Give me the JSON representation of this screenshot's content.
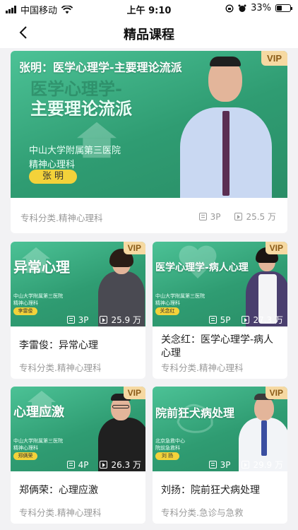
{
  "status_bar": {
    "carrier": "中国移动",
    "time": "上午 9:10",
    "battery": "33%"
  },
  "nav": {
    "title": "精品课程"
  },
  "featured": {
    "vip": "VIP",
    "banner_title": "张明：医学心理学-主要理论流派",
    "big_line1": "医学心理学-",
    "big_line2": "主要理论流派",
    "hospital": "中山大学附属第三医院",
    "department": "精神心理科",
    "doctor_tag": "张 明",
    "category": "专科分类.精神心理科",
    "parts": "3P",
    "views": "25.5 万"
  },
  "courses": [
    {
      "vip": "VIP",
      "banner_title": "异常心理",
      "hospital": "中山大学附属第三医院",
      "department": "精神心理科",
      "doctor_tag": "李雷俊",
      "parts": "3P",
      "views": "25.9 万",
      "title": "李雷俊：异常心理",
      "category": "专科分类.精神心理科"
    },
    {
      "vip": "VIP",
      "banner_title": "医学心理学-病人心理",
      "hospital": "中山大学附属第三医院",
      "department": "精神心理科",
      "doctor_tag": "关念红",
      "parts": "5P",
      "views": "27.3 万",
      "title": "关念红：医学心理学-病人心理",
      "category": "专科分类.精神心理科"
    },
    {
      "vip": "VIP",
      "banner_title": "心理应激",
      "hospital": "中山大学附属第三医院",
      "department": "精神心理科",
      "doctor_tag": "郑俩荣",
      "parts": "4P",
      "views": "26.3 万",
      "title": "郑俩荣：心理应激",
      "category": "专科分类.精神心理科"
    },
    {
      "vip": "VIP",
      "banner_title": "院前狂犬病处理",
      "hospital": "北京急救中心",
      "department": "院前急救科",
      "doctor_tag": "刘 扬",
      "parts": "3P",
      "views": "29.9 万",
      "title": "刘扬：院前狂犬病处理",
      "category": "专科分类.急诊与急救"
    }
  ]
}
